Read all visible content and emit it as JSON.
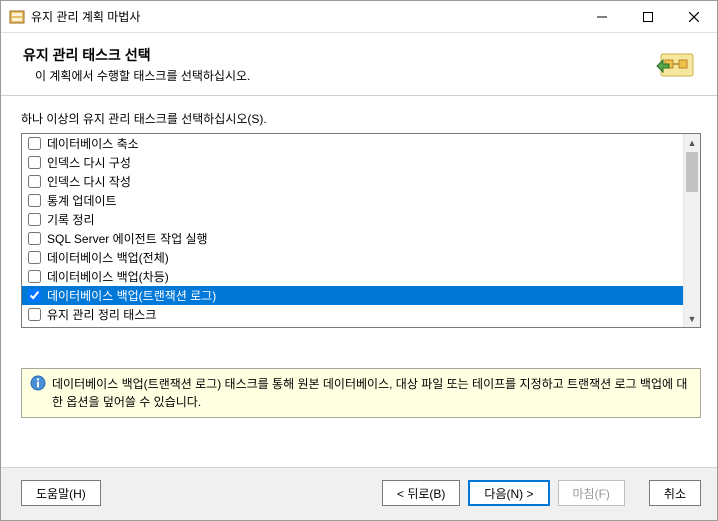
{
  "window": {
    "title": "유지 관리 계획 마법사"
  },
  "header": {
    "title": "유지 관리 태스크 선택",
    "subtitle": "이 계획에서 수행할 태스크를 선택하십시오."
  },
  "list_label": "하나 이상의 유지 관리 태스크를 선택하십시오(S).",
  "tasks": [
    {
      "label": "데이터베이스 축소",
      "checked": false,
      "selected": false
    },
    {
      "label": "인덱스 다시 구성",
      "checked": false,
      "selected": false
    },
    {
      "label": "인덱스 다시 작성",
      "checked": false,
      "selected": false
    },
    {
      "label": "통계 업데이트",
      "checked": false,
      "selected": false
    },
    {
      "label": "기록 정리",
      "checked": false,
      "selected": false
    },
    {
      "label": "SQL Server 에이전트 작업 실행",
      "checked": false,
      "selected": false
    },
    {
      "label": "데이터베이스 백업(전체)",
      "checked": false,
      "selected": false
    },
    {
      "label": "데이터베이스 백업(차등)",
      "checked": false,
      "selected": false
    },
    {
      "label": "데이터베이스 백업(트랜잭션 로그)",
      "checked": true,
      "selected": true
    },
    {
      "label": "유지 관리 정리 태스크",
      "checked": false,
      "selected": false
    }
  ],
  "info_text": "데이터베이스 백업(트랜잭션 로그) 태스크를 통해 원본 데이터베이스, 대상 파일 또는 테이프를 지정하고 트랜잭션 로그 백업에 대한 옵션을 덮어쓸 수 있습니다.",
  "buttons": {
    "help": "도움말(H)",
    "back": "< 뒤로(B)",
    "next": "다음(N) >",
    "finish": "마침(F)",
    "cancel": "취소"
  }
}
